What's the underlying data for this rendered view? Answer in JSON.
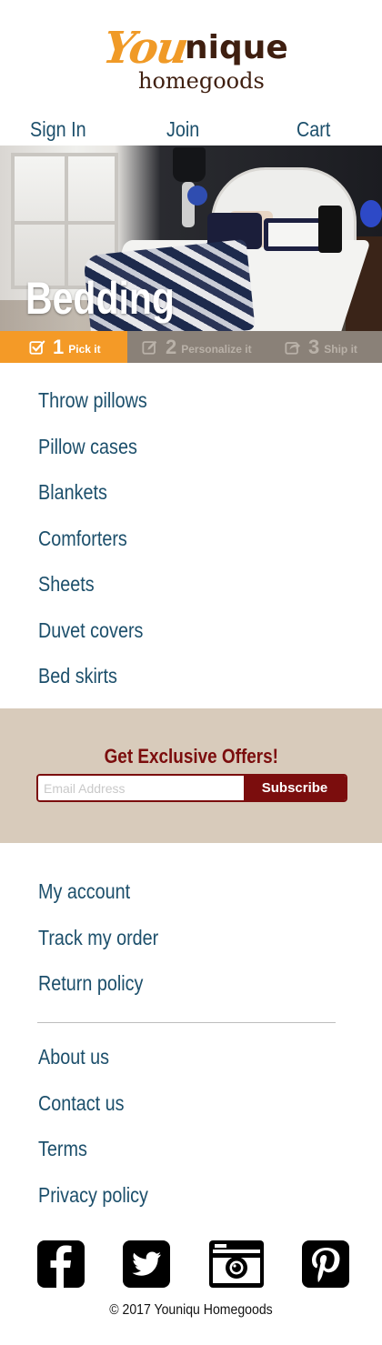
{
  "brand": {
    "logo_part1": "You",
    "logo_part2": "nique",
    "logo_sub": "homegoods",
    "accent": "#f49a27",
    "dark": "#3f1f10"
  },
  "topnav": {
    "signin": "Sign In",
    "join": "Join",
    "cart": "Cart"
  },
  "hero": {
    "title": "Bedding"
  },
  "steps": [
    {
      "num": "1",
      "label": "Pick it",
      "icon": "checkbox-icon",
      "active": true
    },
    {
      "num": "2",
      "label": "Personalize it",
      "icon": "edit-icon",
      "active": false
    },
    {
      "num": "3",
      "label": "Ship it",
      "icon": "share-icon",
      "active": false
    }
  ],
  "categories": [
    "Throw pillows",
    "Pillow cases",
    "Blankets",
    "Comforters",
    "Sheets",
    "Duvet covers",
    "Bed skirts"
  ],
  "offers": {
    "title": "Get Exclusive Offers!",
    "placeholder": "Email Address",
    "email_value": "",
    "button": "Subscribe",
    "color": "#7b0d0d",
    "background": "#d8cbbb"
  },
  "account_links": [
    "My account",
    "Track my order",
    "Return policy"
  ],
  "info_links": [
    "About us",
    "Contact us",
    "Terms",
    "Privacy policy"
  ],
  "social": [
    {
      "icon": "facebook-icon"
    },
    {
      "icon": "twitter-icon"
    },
    {
      "icon": "camera-icon"
    },
    {
      "icon": "pinterest-icon"
    }
  ],
  "footer": {
    "copyright": "© 2017 Youniqu Homegoods"
  },
  "colors": {
    "link": "#1c4f6b",
    "steps_bar": "#8a8178"
  }
}
